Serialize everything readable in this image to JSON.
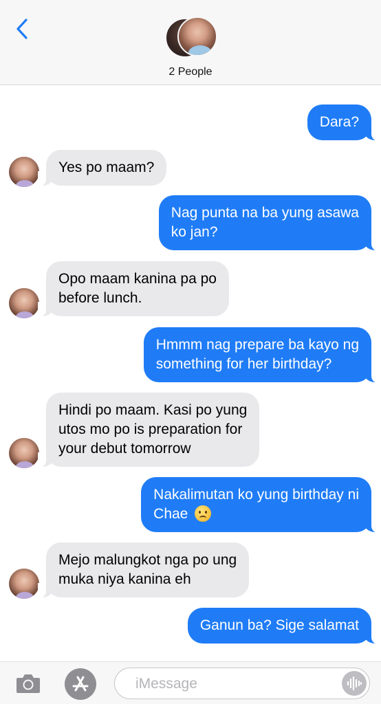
{
  "header": {
    "group_label": "2 People",
    "back_icon": "chevron-left-icon",
    "accent_color": "#1f7cf6"
  },
  "messages": [
    {
      "direction": "outgoing",
      "text": "Dara?"
    },
    {
      "direction": "incoming",
      "text": "Yes po maam?"
    },
    {
      "direction": "outgoing",
      "lines": [
        "Nag punta na ba yung asawa",
        "ko jan?"
      ]
    },
    {
      "direction": "incoming",
      "lines": [
        "Opo maam kanina pa po",
        "before lunch."
      ]
    },
    {
      "direction": "outgoing",
      "lines": [
        "Hmmm nag prepare ba kayo ng",
        "something for her birthday?"
      ]
    },
    {
      "direction": "incoming",
      "lines": [
        "Hindi po maam. Kasi po yung",
        "utos mo po is preparation for",
        "your debut tomorrow"
      ]
    },
    {
      "direction": "outgoing",
      "lines": [
        "Nakalimutan ko yung birthday ni",
        "Chae"
      ],
      "emoji": "frowning-face-icon"
    },
    {
      "direction": "incoming",
      "lines": [
        "Mejo malungkot nga po ung",
        "muka niya kanina eh"
      ]
    },
    {
      "direction": "outgoing",
      "text": "Ganun ba? Sige salamat"
    }
  ],
  "input_bar": {
    "placeholder": "iMessage",
    "camera_icon": "camera-icon",
    "apps_icon": "app-store-icon",
    "audio_icon": "audio-waveform-icon"
  },
  "colors": {
    "outgoing_bubble": "#1f7cf6",
    "incoming_bubble": "#e9e9ec"
  }
}
